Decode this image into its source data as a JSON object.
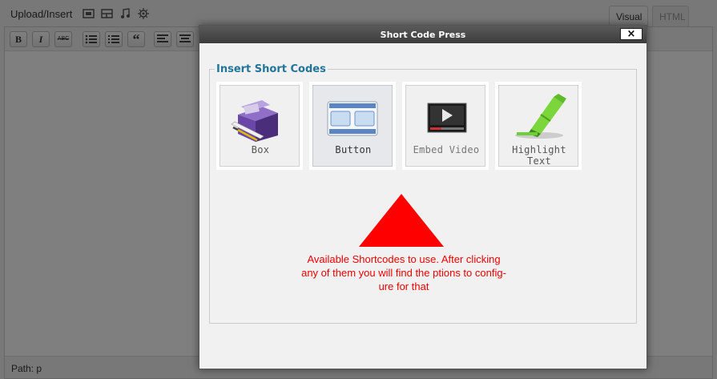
{
  "editor": {
    "upload_label": "Upload/Insert",
    "media_icons": [
      "image-icon",
      "video-icon",
      "audio-icon",
      "media-gear-icon"
    ],
    "tabs": {
      "visual": "Visual",
      "html": "HTML"
    },
    "format_buttons": [
      {
        "name": "bold",
        "label": "B"
      },
      {
        "name": "italic",
        "label": "I"
      },
      {
        "name": "strikethrough",
        "label": "ABC"
      },
      {
        "name": "bullet-list",
        "label": ""
      },
      {
        "name": "numbered-list",
        "label": ""
      },
      {
        "name": "blockquote",
        "label": "“"
      },
      {
        "name": "align-left",
        "label": ""
      },
      {
        "name": "align-center",
        "label": ""
      }
    ],
    "path_label": "Path: p"
  },
  "modal": {
    "title": "Short Code Press",
    "close_label": "×",
    "legend": "Insert Short Codes",
    "shortcodes": [
      {
        "label": "Box",
        "icon": "box-icon"
      },
      {
        "label": "Button",
        "icon": "button-icon"
      },
      {
        "label": "Embed Video",
        "icon": "embed-video-icon"
      },
      {
        "label": "Highlight Text",
        "icon": "highlighter-icon"
      }
    ],
    "annotation": {
      "line1": "Available Shortcodes to use. After clicking",
      "line2": "any of them you will find the ptions to config-",
      "line3": "ure for that"
    },
    "colors": {
      "legend": "#21759b",
      "annotation": "#ee0000",
      "arrow": "#ff0000"
    }
  }
}
